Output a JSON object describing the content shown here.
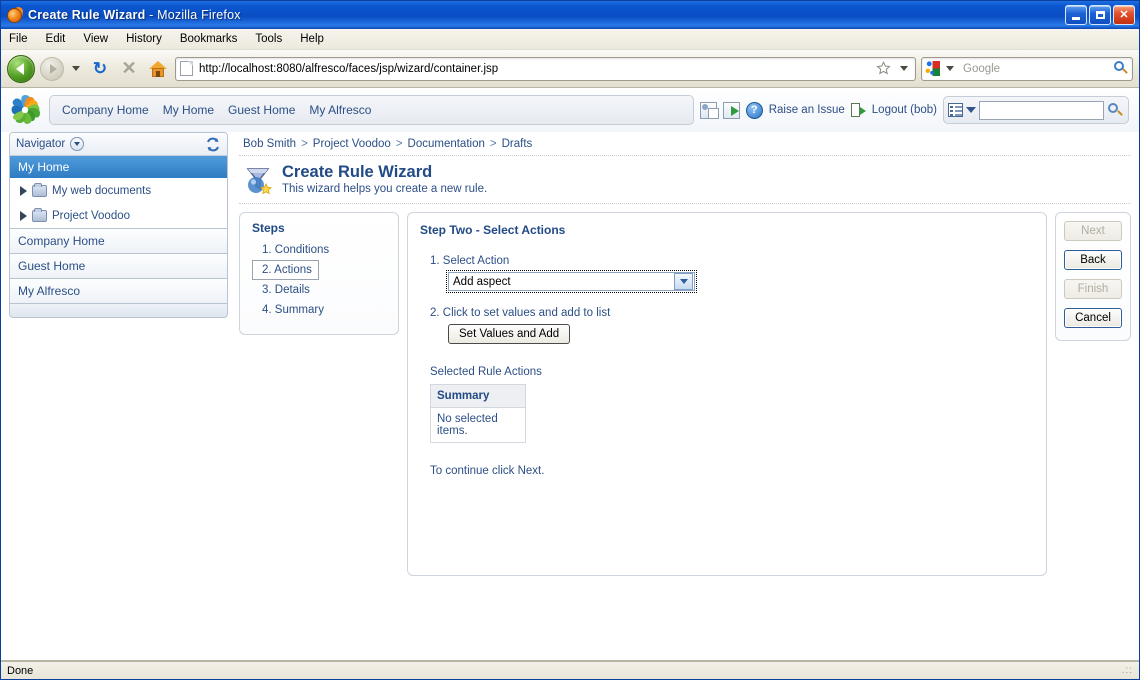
{
  "window": {
    "title_main": "Create Rule Wizard",
    "title_suffix": " - Mozilla Firefox",
    "minimize_label": "Minimize",
    "maximize_label": "Maximize",
    "close_label": "Close"
  },
  "menubar": {
    "items": [
      {
        "label": "File",
        "accel": "F"
      },
      {
        "label": "Edit",
        "accel": "E"
      },
      {
        "label": "View",
        "accel": "V"
      },
      {
        "label": "History",
        "accel": "s"
      },
      {
        "label": "Bookmarks",
        "accel": "B"
      },
      {
        "label": "Tools",
        "accel": "T"
      },
      {
        "label": "Help",
        "accel": "H"
      }
    ]
  },
  "toolbar": {
    "back_label": "Back",
    "forward_label": "Forward",
    "dropdown_label": "Recent pages",
    "reload_glyph": "↻",
    "stop_glyph": "✕",
    "home_label": "Home",
    "url": "http://localhost:8080/alfresco/faces/jsp/wizard/container.jsp",
    "bookmark_label": "Bookmark this page",
    "search_placeholder": "Google",
    "search_value": "",
    "search_engine": "Google"
  },
  "alfresco_header": {
    "logo_name": "alfresco-logo",
    "nav_links": [
      "Company Home",
      "My Home",
      "Guest Home",
      "My Alfresco"
    ],
    "user_details_title": "User Details",
    "invite_title": "Invite",
    "help_glyph": "?",
    "raise_issue_label": "Raise an Issue",
    "logout_label": "Logout (bob)",
    "search_value": "",
    "search_placeholder": ""
  },
  "sidebar": {
    "navigator_label": "Navigator",
    "refresh_glyph": "↻",
    "selected_node": "My Home",
    "tree_items": [
      {
        "label": "My web documents"
      },
      {
        "label": "Project Voodoo"
      }
    ],
    "shortcuts": [
      "Company Home",
      "Guest Home",
      "My Alfresco"
    ]
  },
  "breadcrumb": {
    "items": [
      "Bob Smith",
      "Project Voodoo",
      "Documentation",
      "Drafts"
    ],
    "separator": ">"
  },
  "page": {
    "title": "Create Rule Wizard",
    "subtitle": "This wizard helps you create a new rule.",
    "icon_name": "create-rule-wizard-icon"
  },
  "wizard": {
    "steps_title": "Steps",
    "steps": [
      {
        "label": "1. Conditions",
        "active": false
      },
      {
        "label": "2. Actions",
        "active": true
      },
      {
        "label": "3. Details",
        "active": false
      },
      {
        "label": "4. Summary",
        "active": false
      }
    ],
    "step_heading": "Step Two - Select Actions",
    "field1_label": "1.  Select Action",
    "select_value": "Add aspect",
    "select_options": [
      "Add aspect"
    ],
    "field2_label": "2.  Click to set values and add to list",
    "set_values_button": "Set Values and Add",
    "selected_actions_label": "Selected Rule Actions",
    "table_header": "Summary",
    "table_empty_cell": "No selected items.",
    "continue_text": "To continue click Next.",
    "buttons": [
      {
        "label": "Next",
        "enabled": false
      },
      {
        "label": "Back",
        "enabled": true
      },
      {
        "label": "Finish",
        "enabled": false
      },
      {
        "label": "Cancel",
        "enabled": true
      }
    ]
  },
  "statusbar": {
    "text": "Done"
  },
  "colors": {
    "titlebar_blue": "#0a56cf",
    "alfresco_link": "#2c4f86",
    "heading_blue": "#224a85",
    "selection_blue": "#2f7cc4"
  }
}
